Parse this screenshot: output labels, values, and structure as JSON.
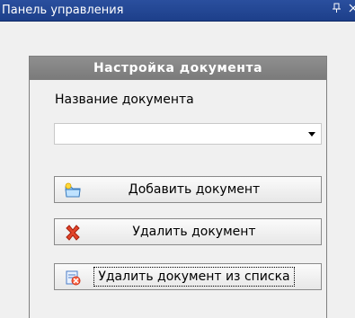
{
  "window": {
    "title": "Панель управления"
  },
  "panel": {
    "header": "Настройка документа",
    "doc_name_label": "Название документа",
    "doc_name_value": ""
  },
  "buttons": {
    "add": "Добавить документ",
    "delete": "Удалить документ",
    "remove_from_list": "Удалить документ из списка"
  },
  "icons": {
    "add": "folder-add-icon",
    "delete": "red-x-icon",
    "remove": "remove-from-list-icon"
  }
}
